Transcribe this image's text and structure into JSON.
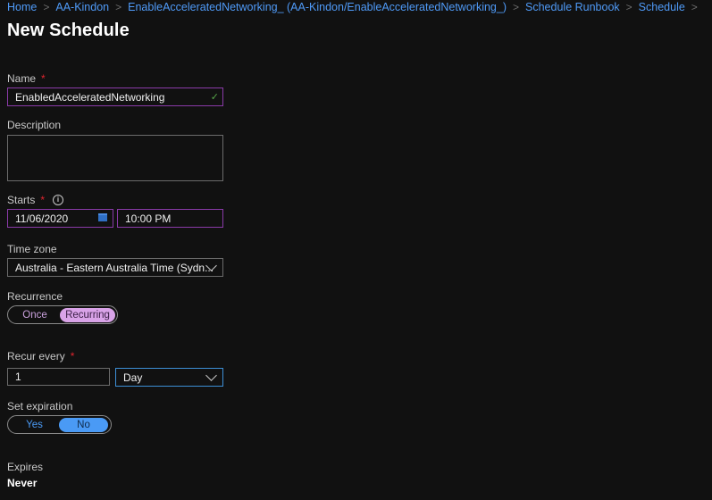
{
  "breadcrumb": {
    "items": [
      "Home",
      "AA-Kindon",
      "EnableAcceleratedNetworking_ (AA-Kindon/EnableAcceleratedNetworking_)",
      "Schedule Runbook",
      "Schedule"
    ],
    "separator": ">"
  },
  "page": {
    "title": "New Schedule"
  },
  "form": {
    "name": {
      "label": "Name",
      "required": "*",
      "value": "EnabledAcceleratedNetworking",
      "valid_icon": "✓"
    },
    "description": {
      "label": "Description",
      "value": ""
    },
    "starts": {
      "label": "Starts",
      "required": "*",
      "info_icon": "i",
      "date": "11/06/2020",
      "time": "10:00 PM"
    },
    "time_zone": {
      "label": "Time zone",
      "selected": "Australia - Eastern Australia Time (Sydn..."
    },
    "recurrence": {
      "label": "Recurrence",
      "options": [
        "Once",
        "Recurring"
      ],
      "selected": "Recurring"
    },
    "recur_every": {
      "label": "Recur every",
      "required": "*",
      "interval": "1",
      "unit": "Day"
    },
    "set_expiration": {
      "label": "Set expiration",
      "options": [
        "Yes",
        "No"
      ],
      "selected": "No"
    },
    "expires": {
      "label": "Expires",
      "value": "Never"
    }
  },
  "colors": {
    "link": "#4f9af7",
    "required": "#e0252f",
    "invalid_border": "#8a3aa8",
    "focus_border": "#3d8fd6",
    "recurrence_selected_bg": "#d9a3e8",
    "expiration_selected_bg": "#4a9af5",
    "valid_check": "#57a64a"
  }
}
